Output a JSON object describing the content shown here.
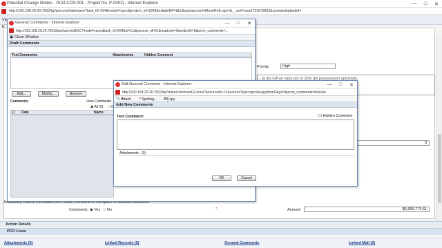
{
  "browser": {
    "title": "Potential Change Orders - PCO-CCR-001 - Project No. P-0002) - Internet Explorer",
    "url": "http://192.168.20.26:7002/bp/process/task/open?task_id=294&model=upco&project_id=1009&initiateBP=&bulkautoaccept=&fromRefLogo=&__uref=uuu9731673f0t2&caveatsteptaskid="
  },
  "background": {
    "priority_label": "Priority:",
    "priority_value": "High",
    "description_text": "...la del IVA un valor por el 10% del presupuesto aprobado.",
    "amount_label": "Amount",
    "amount_value": "$6,990,773.61",
    "zero_value": "0",
    "add_modify_note": "Add/Modify costs in the Detail Form / Insert comments in the space of General Comments",
    "comments_label": "Comments:",
    "comments_yes": "Yes",
    "comments_no": "No",
    "required_star": "*",
    "left_label": "Vie",
    "left_label2": "E",
    "tab_action_details": "Action Details",
    "tab_pco_lines": "PCO Lines",
    "links": [
      "Attachments (0)",
      "Linked Records (0)",
      "General Comments",
      "Linked Mail (0)"
    ]
  },
  "popup1": {
    "title": "General Comments - Internet Explorer",
    "url": "http://192.168.20.26:7002/bp/share/editGC?model=upco&task_id=294&id=11&process_id=61&readonly=false&edit=1&perm_comments=...",
    "close_window": "Close Window",
    "draft_comments": "Draft Comments",
    "col_text": "Text Comments",
    "col_attachments": "Attachments",
    "col_hidden": "Hidden Comment",
    "btn_add": "Add...",
    "btn_modify": "Modify...",
    "btn_remove": "Remove",
    "comments_section": "Comments",
    "view_comments": "View Comments",
    "all_label": "All (0)",
    "hid_label": "Hid",
    "col_date": "Date",
    "col_name": "Name"
  },
  "popup2": {
    "title": "Edit General Comment - Internet Explorer",
    "url": "http://192.168.20.26:7002/bp/share/commentGC/new?&sourceid=-11&sourceType=upco&copyfromFlag=0&perm_comments=false&n",
    "attach": "Attach",
    "spelling": "Spelling...",
    "copy_from": "Copy From",
    "add_new_comments": "Add New Comments",
    "text_comment_label": "Text Comment:",
    "hidden_comment_label": "Hidden Comment",
    "text_value": "",
    "attachments": "Attachments : (0)",
    "ok": "OK",
    "cancel": "Cancel"
  }
}
